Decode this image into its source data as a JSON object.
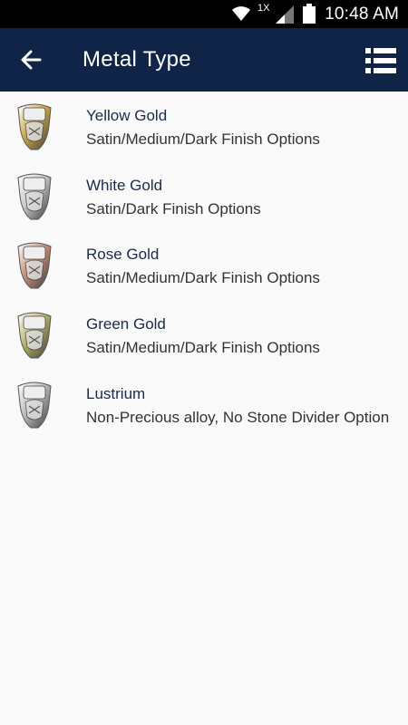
{
  "status_bar": {
    "time": "10:48 AM",
    "network_label": "1X",
    "icons": [
      "wifi-icon",
      "signal-icon",
      "battery-icon"
    ]
  },
  "app_bar": {
    "title": "Metal Type",
    "back_icon": "arrow-left-icon",
    "menu_icon": "list-menu-icon",
    "background": "#0f2446"
  },
  "metals": [
    {
      "name": "Yellow Gold",
      "description": "Satin/Medium/Dark Finish Options",
      "tone": "#c9a94e"
    },
    {
      "name": "White Gold",
      "description": "Satin/Dark Finish Options",
      "tone": "#c8c8c8"
    },
    {
      "name": "Rose Gold",
      "description": "Satin/Medium/Dark Finish Options",
      "tone": "#c9917a"
    },
    {
      "name": "Green Gold",
      "description": "Satin/Medium/Dark Finish Options",
      "tone": "#b8b068"
    },
    {
      "name": "Lustrium",
      "description": "Non-Precious alloy, No Stone Divider Option",
      "tone": "#bdbdbd"
    }
  ]
}
